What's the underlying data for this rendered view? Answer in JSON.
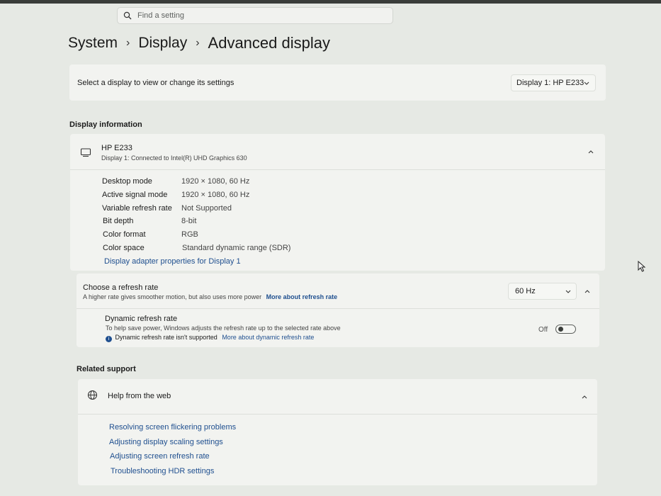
{
  "search": {
    "placeholder": "Find a setting"
  },
  "breadcrumb": {
    "items": [
      "System",
      "Display",
      "Advanced display"
    ]
  },
  "select_display": {
    "label": "Select a display to view or change its settings",
    "value": "Display 1: HP E233"
  },
  "display_information": {
    "heading": "Display information",
    "monitor_name": "HP E233",
    "monitor_subtitle": "Display 1: Connected to Intel(R) UHD Graphics 630",
    "rows": [
      {
        "label": "Desktop mode",
        "value": "1920 × 1080, 60 Hz"
      },
      {
        "label": "Active signal mode",
        "value": "1920 × 1080, 60 Hz"
      },
      {
        "label": "Variable refresh rate",
        "value": "Not Supported"
      },
      {
        "label": "Bit depth",
        "value": "8-bit"
      },
      {
        "label": "Color format",
        "value": "RGB"
      },
      {
        "label": "Color space",
        "value": "Standard dynamic range (SDR)"
      }
    ],
    "adapter_link": "Display adapter properties for Display 1"
  },
  "refresh_rate": {
    "title": "Choose a refresh rate",
    "description": "A higher rate gives smoother motion, but also uses more power",
    "link": "More about refresh rate",
    "value": "60 Hz"
  },
  "dynamic_refresh": {
    "title": "Dynamic refresh rate",
    "description": "To help save power, Windows adjusts the refresh rate up to the selected rate above",
    "notice": "Dynamic refresh rate isn't supported",
    "link": "More about dynamic refresh rate",
    "toggle_label": "Off",
    "toggle_on": false
  },
  "related_support": {
    "heading": "Related support",
    "help_title": "Help from the web",
    "links": [
      "Resolving screen flickering problems",
      "Adjusting display scaling settings",
      "Adjusting screen refresh rate",
      "Troubleshooting HDR settings"
    ]
  },
  "colors": {
    "accent_link": "#1f4f8f",
    "background": "#e6e9e4",
    "card": "#f2f3f0"
  }
}
